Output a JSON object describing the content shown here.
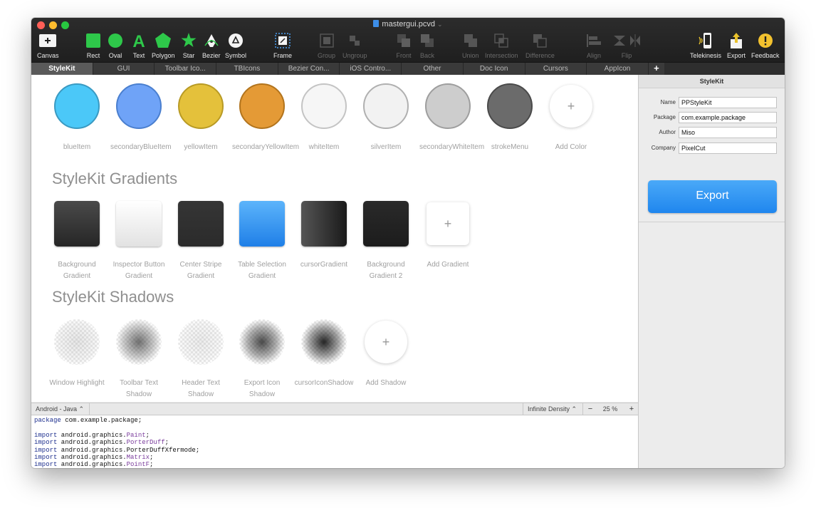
{
  "window": {
    "title": "mastergui.pcvd"
  },
  "toolbar": {
    "canvas": "Canvas",
    "rect": "Rect",
    "oval": "Oval",
    "text": "Text",
    "polygon": "Polygon",
    "star": "Star",
    "bezier": "Bezier",
    "symbol": "Symbol",
    "frame": "Frame",
    "group": "Group",
    "ungroup": "Ungroup",
    "front": "Front",
    "back": "Back",
    "union": "Union",
    "intersection": "Intersection",
    "difference": "Difference",
    "align": "Align",
    "flip": "Flip",
    "telekinesis": "Telekinesis",
    "export": "Export",
    "feedback": "Feedback",
    "icons": [
      "plus-icon",
      "rect-icon",
      "oval-icon",
      "text-icon",
      "polygon-icon",
      "star-icon",
      "bezier-pen-icon",
      "symbol-icon",
      "frame-icon",
      "group-icon",
      "ungroup-icon",
      "front-icon",
      "back-icon",
      "union-icon",
      "intersection-icon",
      "difference-icon",
      "align-icon",
      "flip-icon",
      "phone-icon",
      "share-icon",
      "warning-icon"
    ]
  },
  "tabs": [
    "StyleKit",
    "GUI",
    "Toolbar Ico...",
    "TBIcons",
    "Bezier Con...",
    "iOS Contro...",
    "Other",
    "Doc Icon",
    "Cursors",
    "AppIcon"
  ],
  "tab_add": "+",
  "colors": {
    "items": [
      {
        "label": "blueItem",
        "color": "#4bc8f8"
      },
      {
        "label": "secondaryBlueItem",
        "color": "#6fa3f7"
      },
      {
        "label": "yellowItem",
        "color": "#e4c13b"
      },
      {
        "label": "secondaryYellowItem",
        "color": "#e49a36"
      },
      {
        "label": "whiteItem",
        "color": "#f6f6f6"
      },
      {
        "label": "silverItem",
        "color": "#f2f2f2"
      },
      {
        "label": "secondaryWhiteItem",
        "color": "#cdcdcd"
      },
      {
        "label": "strokeMenu",
        "color": "#6b6b6b"
      }
    ],
    "add_label": "Add Color",
    "add_symbol": "+"
  },
  "gradients": {
    "title": "StyleKit Gradients",
    "items": [
      {
        "label": "Background Gradient"
      },
      {
        "label": "Inspector Button Gradient"
      },
      {
        "label": "Center Stripe Gradient"
      },
      {
        "label": "Table Selection Gradient"
      },
      {
        "label": "cursorGradient"
      },
      {
        "label": "Background Gradient 2"
      }
    ],
    "add_label": "Add Gradient",
    "add_symbol": "+"
  },
  "shadows": {
    "title": "StyleKit Shadows",
    "items": [
      {
        "label": "Window Highlight"
      },
      {
        "label": "Toolbar Text Shadow"
      },
      {
        "label": "Header Text Shadow"
      },
      {
        "label": "Export Icon Shadow"
      },
      {
        "label": "cursorIconShadow"
      }
    ],
    "add_label": "Add Shadow",
    "add_symbol": "+"
  },
  "statusbar": {
    "language": "Android - Java ⌃",
    "density": "Infinite Density ⌃",
    "minus": "−",
    "zoom": "25 %",
    "plus": "+"
  },
  "code": {
    "package": {
      "kw": "package",
      "rest": " com.example.package;"
    },
    "imports": [
      {
        "kw": "import",
        "pre": " android.graphics.",
        "cls": "Paint",
        "post": ";"
      },
      {
        "kw": "import",
        "pre": " android.graphics.",
        "cls": "PorterDuff",
        "post": ";"
      },
      {
        "kw": "import",
        "pre": " android.graphics.PorterDuffXfermode;",
        "cls": "",
        "post": ""
      },
      {
        "kw": "import",
        "pre": " android.graphics.",
        "cls": "Matrix",
        "post": ";"
      },
      {
        "kw": "import",
        "pre": " android.graphics.",
        "cls": "PointF",
        "post": ";"
      }
    ]
  },
  "inspector": {
    "title": "StyleKit",
    "fields": [
      {
        "label": "Name",
        "value": "PPStyleKit"
      },
      {
        "label": "Package",
        "value": "com.example.package"
      },
      {
        "label": "Author",
        "value": "Miso"
      },
      {
        "label": "Company",
        "value": "PixelCut"
      }
    ],
    "export_label": "Export"
  }
}
